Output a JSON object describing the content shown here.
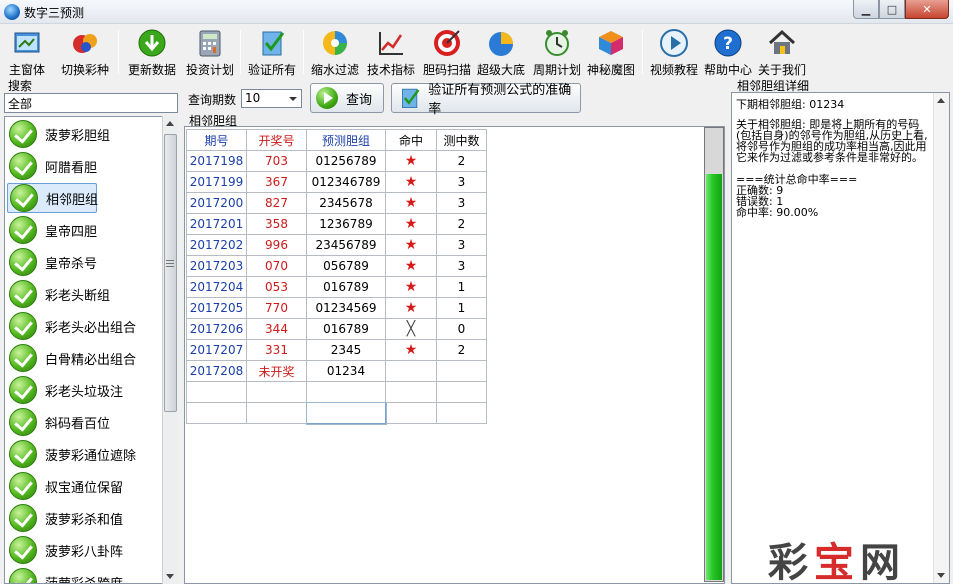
{
  "window": {
    "title": "数字三预测"
  },
  "toolbar": [
    {
      "id": "main",
      "label": "主窗体",
      "icon": "main-window-icon"
    },
    {
      "id": "switch",
      "label": "切换彩种",
      "icon": "switch-lottery-icon"
    },
    {
      "id": "update",
      "label": "更新数据",
      "icon": "download-icon"
    },
    {
      "id": "invest",
      "label": "投资计划",
      "icon": "calculator-icon"
    },
    {
      "id": "verify",
      "label": "验证所有",
      "icon": "verify-icon"
    },
    {
      "id": "filter",
      "label": "缩水过滤",
      "icon": "filter-icon"
    },
    {
      "id": "tech",
      "label": "技术指标",
      "icon": "chart-icon"
    },
    {
      "id": "scan",
      "label": "胆码扫描",
      "icon": "target-icon"
    },
    {
      "id": "super",
      "label": "超级大底",
      "icon": "pie-icon"
    },
    {
      "id": "cycle",
      "label": "周期计划",
      "icon": "clock-icon"
    },
    {
      "id": "magic",
      "label": "神秘魔图",
      "icon": "cube-icon"
    },
    {
      "id": "video",
      "label": "视频教程",
      "icon": "play-icon"
    },
    {
      "id": "help",
      "label": "帮助中心",
      "icon": "help-icon"
    },
    {
      "id": "about",
      "label": "关于我们",
      "icon": "home-icon"
    }
  ],
  "search": {
    "label": "搜索",
    "value": "全部"
  },
  "formula_list": [
    "菠萝彩胆组",
    "阿腊看胆",
    "相邻胆组",
    "皇帝四胆",
    "皇帝杀号",
    "彩老头断组",
    "彩老头必出组合",
    "白骨精必出组合",
    "彩老头垃圾注",
    "斜码看百位",
    "菠萝彩通位遮除",
    "叔宝通位保留",
    "菠萝彩杀和值",
    "菠萝彩八卦阵",
    "菠萝彩杀跨度"
  ],
  "selected_formula_index": 2,
  "query": {
    "label": "查询期数",
    "value": "10",
    "button": "查询",
    "verify_button": "验证所有预测公式的准确率"
  },
  "grid": {
    "caption": "相邻胆组",
    "headers": [
      "期号",
      "开奖号",
      "预测胆组",
      "命中",
      "测中数"
    ],
    "rows": [
      {
        "period": "2017198",
        "draw": "703",
        "pred": "01256789",
        "hit": "★",
        "count": "2"
      },
      {
        "period": "2017199",
        "draw": "367",
        "pred": "012346789",
        "hit": "★",
        "count": "3"
      },
      {
        "period": "2017200",
        "draw": "827",
        "pred": "2345678",
        "hit": "★",
        "count": "3"
      },
      {
        "period": "2017201",
        "draw": "358",
        "pred": "1236789",
        "hit": "★",
        "count": "2"
      },
      {
        "period": "2017202",
        "draw": "996",
        "pred": "23456789",
        "hit": "★",
        "count": "3"
      },
      {
        "period": "2017203",
        "draw": "070",
        "pred": "056789",
        "hit": "★",
        "count": "3"
      },
      {
        "period": "2017204",
        "draw": "053",
        "pred": "016789",
        "hit": "★",
        "count": "1"
      },
      {
        "period": "2017205",
        "draw": "770",
        "pred": "01234569",
        "hit": "★",
        "count": "1"
      },
      {
        "period": "2017206",
        "draw": "344",
        "pred": "016789",
        "hit": "╳",
        "count": "0"
      },
      {
        "period": "2017207",
        "draw": "331",
        "pred": "2345",
        "hit": "★",
        "count": "2"
      },
      {
        "period": "2017208",
        "draw": "未开奖",
        "pred": "01234",
        "hit": "",
        "count": ""
      }
    ]
  },
  "progress": {
    "fraction": 0.9
  },
  "detail": {
    "title": "相邻胆组详细",
    "next": "下期相邻胆组: 01234",
    "description": "关于相邻胆组: 即是将上期所有的号码(包括自身)的邻号作为胆组,从历史上看,将邻号作为胆组的成功率相当高,因此用它来作为过滤或参考条件是非常好的。",
    "stats_title": "===统计总命中率===",
    "correct": "正确数: 9",
    "wrong": "错误数: 1",
    "rate": "命中率: 90.00%"
  },
  "watermark": {
    "text1": "彩",
    "text2": "宝",
    "text3": "网"
  }
}
